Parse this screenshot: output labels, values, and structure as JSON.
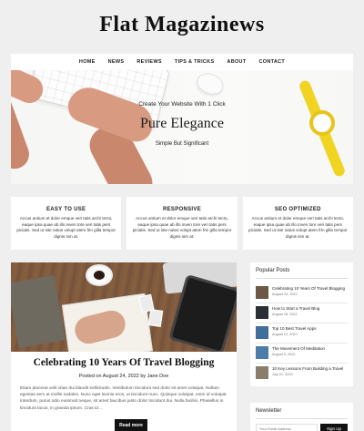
{
  "site": {
    "title": "Flat Magazinews"
  },
  "nav": {
    "items": [
      "HOME",
      "NEWS",
      "REVIEWS",
      "TIPS & TRICKS",
      "ABOUT",
      "CONTACT"
    ]
  },
  "hero": {
    "subtitle": "Create Your Website With 1 Click",
    "title": "Pure Elegance",
    "tagline": "Simple But Significant"
  },
  "features": [
    {
      "title": "EASY TO USE",
      "text": "Accus antium et dolor emque veri tatis archi tecto, eaque ipsa quae ab illo inven tore veri tatis pers piciatis. Sed ut iste natus volupt atem frin gilla tempor dignis sim at."
    },
    {
      "title": "RESPONSIVE",
      "text": "Accus antium et dolor emque veri tatis archi tecto, eaque ipsa quae ab illo inven tore veri tatis pers piciatis. Sed ut iste natus volupt atem frin gilla tempor dignis sim at."
    },
    {
      "title": "SEO OPTIMIZED",
      "text": "Accus antium et dolor emque veri tatis archi tecto, eaque ipsa quae ab illo inven tore veri tatis pers piciatis. Sed ut iste natus volupt atem frin gilla tempor dignis sim at."
    }
  ],
  "post": {
    "title": "Celebrating 10 Years Of Travel Blogging",
    "posted_on_label": "Posted on",
    "date": "August 24, 2022",
    "by_label": "by",
    "author": "Jane Doe",
    "excerpt": "Etiam placerat velit vitae dui blandit sollicitudin. Vestibulum tincidunt sed dolor sit amet volutpat. Nullam egestas sem at mollis sodales. Nunc eget lacinia eros, ut tincidunt nunc. Quisque volutpat, enim id volutpat interdum, purus odio euismod neque, sit amet faucibus justo dolor tincidunt dui. Nulla facilisi. Phasellus in tincidunt lacus, in gravida ipsum. Cras id…",
    "read_more": "Read more"
  },
  "popular_posts": {
    "title": "Popular Posts",
    "items": [
      {
        "title": "Celebrating 10 Years Of Travel Blogging",
        "date": "August 24, 2022",
        "color": "#6b5845"
      },
      {
        "title": "How to Start a Travel Blog",
        "date": "August 18, 2022",
        "color": "#2a2e35"
      },
      {
        "title": "Top 10 Best Travel Apps",
        "date": "August 12, 2022",
        "color": "#3f6f9a"
      },
      {
        "title": "The Movement Of Meditation",
        "date": "August 9, 2022",
        "color": "#4b7da8"
      },
      {
        "title": "10 Key Lessons From Building a Travel",
        "date": "July 21, 2022",
        "color": "#8a7d6b"
      }
    ]
  },
  "newsletter": {
    "title": "Newsletter",
    "placeholder": "Your Email Address",
    "button": "Sign Up"
  }
}
